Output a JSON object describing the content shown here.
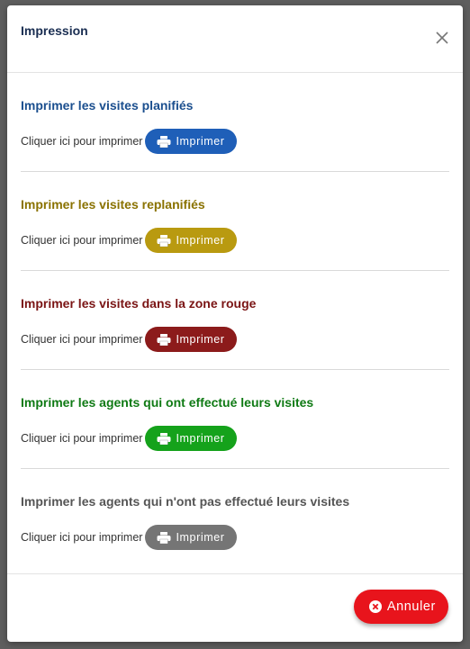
{
  "modal": {
    "title": "Impression",
    "close_icon": "close-icon"
  },
  "sections": [
    {
      "title": "Imprimer les visites planifiés",
      "title_color": "#1a4e8e",
      "label": "Cliquer ici pour imprimer",
      "button_label": "Imprimer",
      "button_color": "#1f5fb8",
      "icon": "printer-icon"
    },
    {
      "title": "Imprimer les visites replanifiés",
      "title_color": "#8a7200",
      "label": "Cliquer ici pour imprimer",
      "button_label": "Imprimer",
      "button_color": "#b99a10",
      "icon": "printer-icon"
    },
    {
      "title": "Imprimer les visites dans la zone rouge",
      "title_color": "#7a1414",
      "label": "Cliquer ici pour imprimer",
      "button_label": "Imprimer",
      "button_color": "#8c1b1b",
      "icon": "printer-icon"
    },
    {
      "title": "Imprimer les agents qui ont effectué leurs visites",
      "title_color": "#0f7a14",
      "label": "Cliquer ici pour imprimer",
      "button_label": "Imprimer",
      "button_color": "#15a21b",
      "icon": "printer-icon"
    },
    {
      "title": "Imprimer les agents qui n'ont pas effectué leurs visites",
      "title_color": "#555555",
      "label": "Cliquer ici pour imprimer",
      "button_label": "Imprimer",
      "button_color": "#757575",
      "icon": "printer-icon"
    }
  ],
  "footer": {
    "cancel_label": "Annuler",
    "cancel_color": "#e8141c",
    "cancel_icon": "close-circle-icon"
  }
}
